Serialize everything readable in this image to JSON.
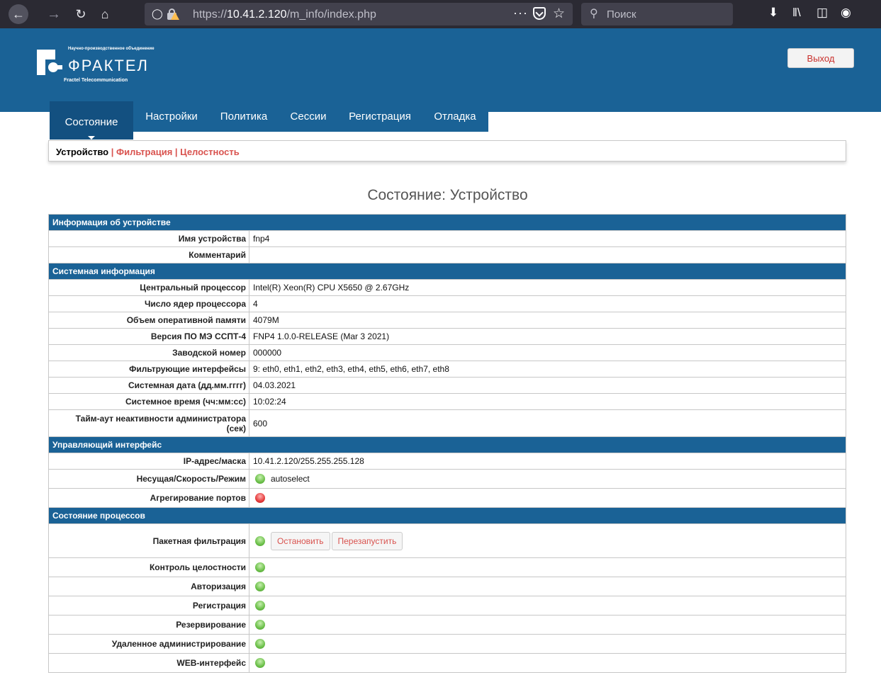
{
  "browser": {
    "url_prefix": "https://",
    "url_host": "10.41.2.120",
    "url_path": "/m_info/index.php",
    "search_placeholder": "Поиск",
    "dots": "···"
  },
  "header": {
    "logo_small": "Научно-производственное объединение",
    "logo_name": "ФРАКТЕЛ",
    "logo_sub": "Fractel Telecommunication",
    "logout_label": "Выход"
  },
  "nav": {
    "tabs": [
      {
        "label": "Состояние",
        "active": true
      },
      {
        "label": "Настройки"
      },
      {
        "label": "Политика"
      },
      {
        "label": "Сессии"
      },
      {
        "label": "Регистрация"
      },
      {
        "label": "Отладка"
      }
    ]
  },
  "subnav": {
    "current": "Устройство",
    "links": [
      "| Фильтрация",
      "| Целостность"
    ]
  },
  "page_title": "Состояние: Устройство",
  "sections": {
    "device": {
      "title": "Информация об устройстве",
      "rows": [
        {
          "key": "Имя устройства",
          "value": "fnp4"
        },
        {
          "key": "Комментарий",
          "value": ""
        }
      ]
    },
    "system": {
      "title": "Системная информация",
      "rows": [
        {
          "key": "Центральный процессор",
          "value": "Intel(R) Xeon(R) CPU X5650 @ 2.67GHz"
        },
        {
          "key": "Число ядер процессора",
          "value": "4"
        },
        {
          "key": "Объем оперативной памяти",
          "value": "4079M"
        },
        {
          "key": "Версия ПО МЭ ССПТ-4",
          "value": "FNP4 1.0.0-RELEASE (Mar 3 2021)"
        },
        {
          "key": "Заводской номер",
          "value": "000000"
        },
        {
          "key": "Фильтрующие интерфейсы",
          "value": "9: eth0, eth1, eth2, eth3, eth4, eth5, eth6, eth7, eth8"
        },
        {
          "key": "Системная дата (дд.мм.гггг)",
          "value": "04.03.2021"
        },
        {
          "key": "Системное время (чч:мм:сс)",
          "value": "10:02:24"
        },
        {
          "key": "Тайм-аут неактивности администратора (сек)",
          "value": "600"
        }
      ]
    },
    "mgmt": {
      "title": "Управляющий интерфейс",
      "ip_key": "IP-адрес/маска",
      "ip_value": "10.41.2.120/255.255.255.128",
      "carrier_key": "Несущая/Скорость/Режим",
      "carrier_status": "green",
      "carrier_value": "autoselect",
      "lagg_key": "Агрегирование портов",
      "lagg_status": "red"
    },
    "processes": {
      "title": "Состояние процессов",
      "filter_key": "Пакетная фильтрация",
      "filter_status": "green",
      "stop_label": "Остановить",
      "restart_label": "Перезапустить",
      "rows": [
        {
          "key": "Контроль целостности",
          "status": "green"
        },
        {
          "key": "Авторизация",
          "status": "green"
        },
        {
          "key": "Регистрация",
          "status": "green"
        },
        {
          "key": "Резервирование",
          "status": "green"
        },
        {
          "key": "Удаленное администрирование",
          "status": "green"
        },
        {
          "key": "WEB-интерфейс",
          "status": "green"
        }
      ]
    }
  }
}
